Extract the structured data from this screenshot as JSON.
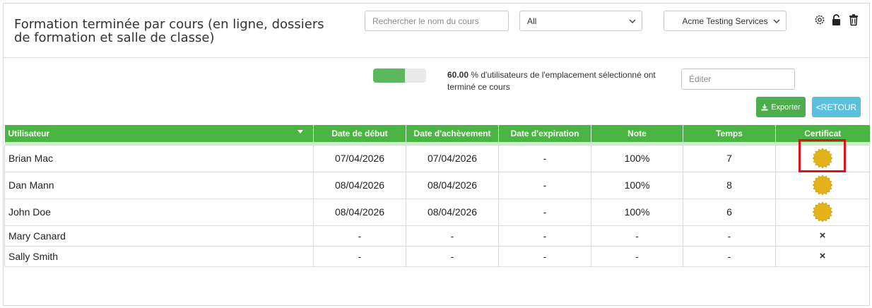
{
  "header": {
    "title": "Formation terminée par cours (en ligne, dossiers de formation et salle de classe)"
  },
  "search": {
    "placeholder": "Rechercher le nom du cours"
  },
  "filter_select": {
    "value": "All"
  },
  "company_select": {
    "value": "Acme Testing Services"
  },
  "progress": {
    "value": 0.6,
    "percent_text": "60.00",
    "text": " % d'utilisateurs de l'emplacement sélectionné ont terminé ce cours"
  },
  "edit": {
    "placeholder": "Éditer"
  },
  "buttons": {
    "export": "Exporter",
    "back": "<RETOUR"
  },
  "colors": {
    "header_green": "#4bb543",
    "progress_green": "#5cb85c",
    "back_blue": "#5bc0de",
    "highlight_red": "#d9141b",
    "seal_gold": "#e3b21a"
  },
  "table": {
    "columns": [
      "Utilisateur",
      "Date de début",
      "Date d'achèvement",
      "Date d'expiration",
      "Note",
      "Temps",
      "Certificat"
    ],
    "rows": [
      {
        "user": "Brian Mac",
        "start": "07/04/2026",
        "end": "07/04/2026",
        "expiry": "-",
        "grade": "100%",
        "time": "7",
        "certificate": "seal-icon"
      },
      {
        "user": "Dan Mann",
        "start": "08/04/2026",
        "end": "08/04/2026",
        "expiry": "-",
        "grade": "100%",
        "time": "8",
        "certificate": "seal-icon"
      },
      {
        "user": "John Doe",
        "start": "08/04/2026",
        "end": "08/04/2026",
        "expiry": "-",
        "grade": "100%",
        "time": "6",
        "certificate": "seal-icon"
      },
      {
        "user": "Mary Canard",
        "start": "-",
        "end": "-",
        "expiry": "-",
        "grade": "-",
        "time": "-",
        "certificate": "×"
      },
      {
        "user": "Sally Smith",
        "start": "-",
        "end": "-",
        "expiry": "-",
        "grade": "-",
        "time": "-",
        "certificate": "×"
      }
    ]
  }
}
